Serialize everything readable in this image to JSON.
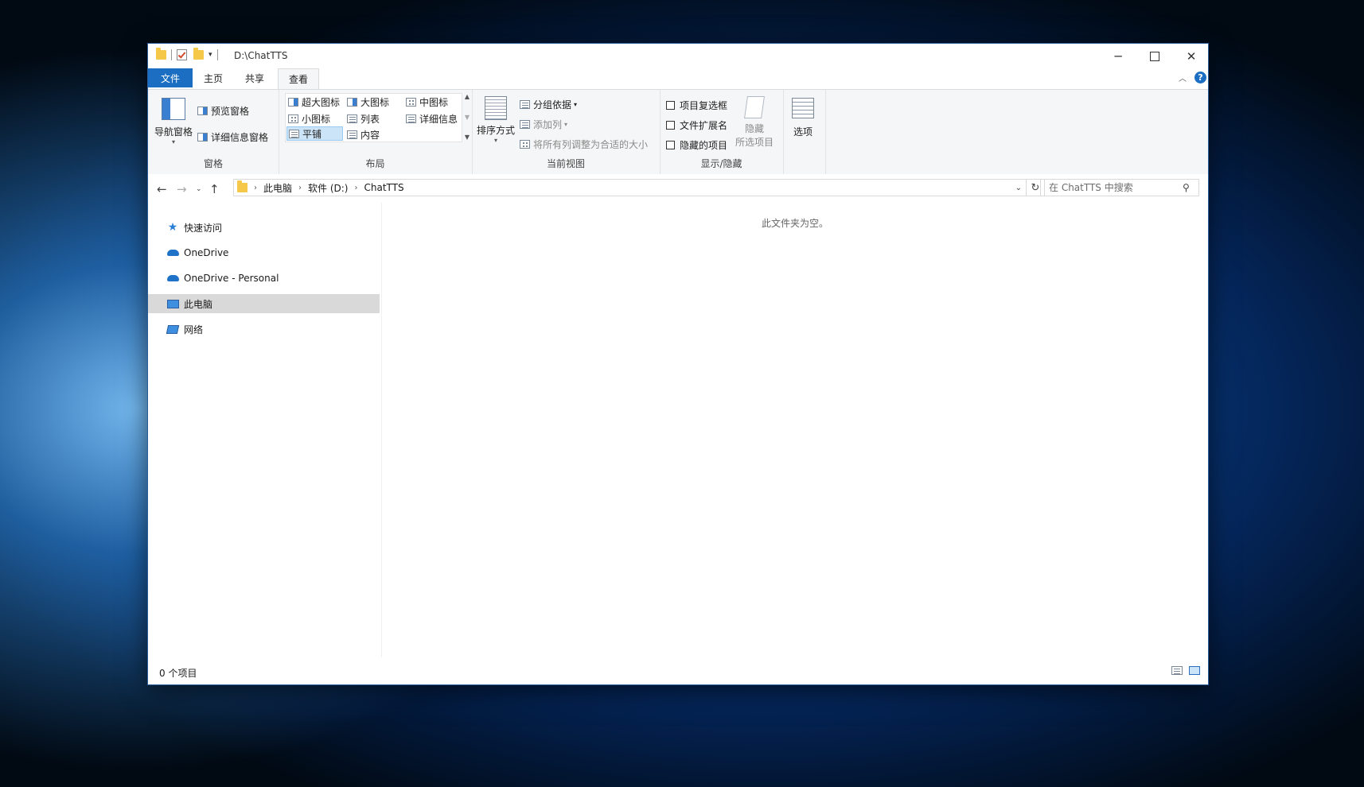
{
  "titlebar": {
    "title": "D:\\ChatTTS",
    "minimize_icon": "minimize-icon",
    "maximize_icon": "maximize-icon",
    "close_icon": "close-icon"
  },
  "tabs": [
    {
      "label": "文件"
    },
    {
      "label": "主页"
    },
    {
      "label": "共享"
    },
    {
      "label": "查看"
    }
  ],
  "ribbon": {
    "panes": {
      "label": "窗格",
      "nav_pane": "导航窗格",
      "preview_pane": "预览窗格",
      "details_pane": "详细信息窗格"
    },
    "layout": {
      "label": "布局",
      "extra_large_icons": "超大图标",
      "large_icons": "大图标",
      "medium_icons": "中图标",
      "small_icons": "小图标",
      "list": "列表",
      "details": "详细信息",
      "tiles": "平铺",
      "content": "内容"
    },
    "current_view": {
      "label": "当前视图",
      "sort_by": "排序方式",
      "group_by": "分组依据",
      "add_columns": "添加列",
      "size_all_columns": "将所有列调整为合适的大小"
    },
    "show_hide": {
      "label": "显示/隐藏",
      "item_check_boxes": "项目复选框",
      "file_name_extensions": "文件扩展名",
      "hidden_items": "隐藏的项目",
      "hide_selected_line1": "隐藏",
      "hide_selected_line2": "所选项目"
    },
    "options": {
      "label": "选项"
    }
  },
  "address": {
    "crumbs": [
      "此电脑",
      "软件 (D:)",
      "ChatTTS"
    ],
    "search_placeholder": "在 ChatTTS 中搜索"
  },
  "navpane": {
    "items": [
      {
        "label": "快速访问",
        "icon": "star-icon"
      },
      {
        "label": "OneDrive",
        "icon": "cloud-icon"
      },
      {
        "label": "OneDrive - Personal",
        "icon": "cloud-icon"
      },
      {
        "label": "此电脑",
        "icon": "computer-icon"
      },
      {
        "label": "网络",
        "icon": "network-icon"
      }
    ]
  },
  "content": {
    "empty_message": "此文件夹为空。"
  },
  "statusbar": {
    "item_count": "0 个项目"
  },
  "colors": {
    "accent": "#1b6ec2",
    "selection": "#d9d9d9",
    "ribbon_bg": "#f5f6f7"
  }
}
